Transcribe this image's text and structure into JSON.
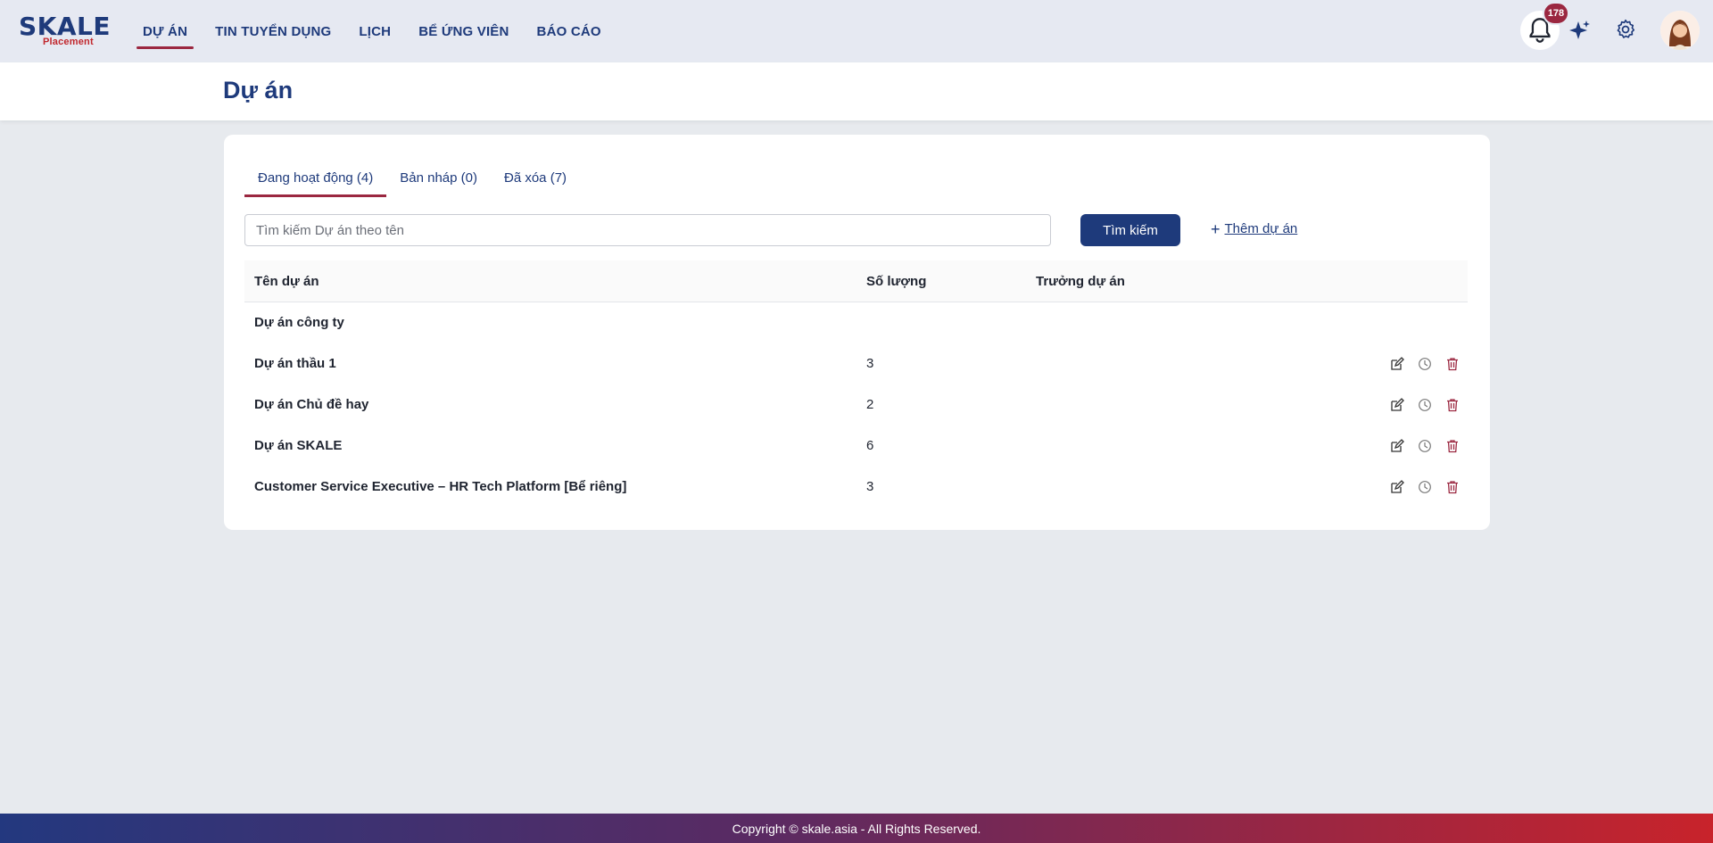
{
  "brand": {
    "logo_main": "SKALE",
    "logo_sub": "Placement"
  },
  "nav": {
    "items": [
      {
        "label": "DỰ ÁN"
      },
      {
        "label": "TIN TUYỂN DỤNG"
      },
      {
        "label": "LỊCH"
      },
      {
        "label": "BỂ ỨNG VIÊN"
      },
      {
        "label": "BÁO CÁO"
      }
    ],
    "active_index": 0
  },
  "header_actions": {
    "notification_count": "178",
    "icons": [
      "bell-icon",
      "sparkle-icon",
      "gear-icon",
      "avatar"
    ]
  },
  "page": {
    "title": "Dự án"
  },
  "tabs": [
    {
      "label": "Đang hoạt động (4)"
    },
    {
      "label": "Bản nháp (0)"
    },
    {
      "label": "Đã xóa (7)"
    }
  ],
  "search": {
    "placeholder": "Tìm kiếm Dự án theo tên",
    "value": "",
    "button_label": "Tìm kiếm"
  },
  "add_project": {
    "label": "Thêm dự án"
  },
  "table": {
    "columns": [
      "Tên dự án",
      "Số lượng",
      "Trưởng dự án"
    ],
    "rows": [
      {
        "name": "Dự án công ty",
        "quantity": "",
        "lead": "",
        "has_actions": false
      },
      {
        "name": "Dự án thầu 1",
        "quantity": "3",
        "lead": "",
        "has_actions": true
      },
      {
        "name": "Dự án Chủ đề hay",
        "quantity": "2",
        "lead": "",
        "has_actions": true
      },
      {
        "name": "Dự án SKALE",
        "quantity": "6",
        "lead": "",
        "has_actions": true
      },
      {
        "name": "Customer Service Executive – HR Tech Platform [Bể riêng]",
        "quantity": "3",
        "lead": "",
        "has_actions": true
      }
    ]
  },
  "footer": {
    "text": "Copyright © skale.asia - All Rights Reserved."
  },
  "colors": {
    "primary": "#1e3a7b",
    "accent": "#9b2740",
    "brand_red": "#c1272d"
  }
}
